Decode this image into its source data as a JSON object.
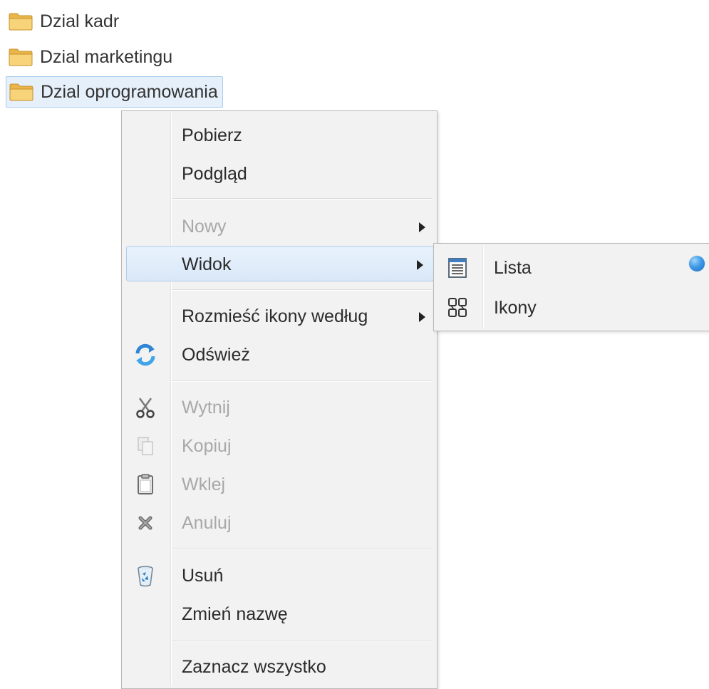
{
  "tree": {
    "folders": [
      {
        "label": "Dzial kadr"
      },
      {
        "label": "Dzial marketingu"
      },
      {
        "label": "Dzial oprogramowania",
        "selected": true
      }
    ],
    "folder_color": "#f2c35a"
  },
  "context_menu": {
    "items": [
      {
        "label": "Pobierz",
        "enabled": true
      },
      {
        "label": "Podgląd",
        "enabled": true
      },
      {
        "label": "Nowy",
        "enabled": false,
        "submenu": true
      },
      {
        "label": "Widok",
        "enabled": true,
        "submenu": true,
        "highlighted": true
      },
      {
        "label": "Rozmieść ikony według",
        "enabled": true,
        "submenu": true
      },
      {
        "label": "Odśwież",
        "enabled": true,
        "icon": "refresh-icon"
      },
      {
        "label": "Wytnij",
        "enabled": false,
        "icon": "scissors-icon"
      },
      {
        "label": "Kopiuj",
        "enabled": false,
        "icon": "copy-icon"
      },
      {
        "label": "Wklej",
        "enabled": false,
        "icon": "clipboard-icon"
      },
      {
        "label": "Anuluj",
        "enabled": false,
        "icon": "cancel-icon"
      },
      {
        "label": "Usuń",
        "enabled": true,
        "icon": "recycle-bin-icon"
      },
      {
        "label": "Zmień nazwę",
        "enabled": true
      },
      {
        "label": "Zaznacz wszystko",
        "enabled": true
      }
    ],
    "highlight_color": "#d9e8f8"
  },
  "view_submenu": {
    "items": [
      {
        "label": "Lista",
        "icon": "list-view-icon",
        "selected": true
      },
      {
        "label": "Ikony",
        "icon": "icons-view-icon",
        "selected": false
      }
    ],
    "radio_color": "#3f9ae6"
  }
}
